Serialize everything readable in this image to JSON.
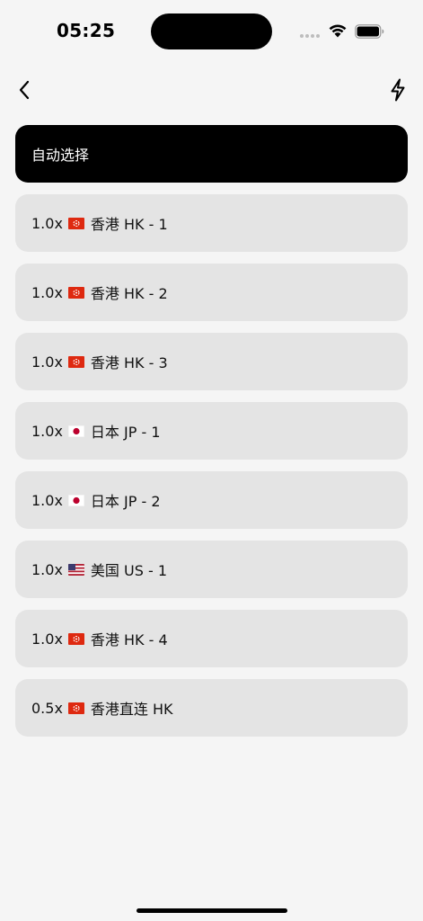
{
  "status_bar": {
    "time": "05:25"
  },
  "nav": {
    "back_icon": "chevron-left-icon",
    "action_icon": "lightning-bolt-icon"
  },
  "servers": [
    {
      "label": "自动选择",
      "selected": true
    },
    {
      "multiplier": "1.0x",
      "flag": "hk",
      "name": "香港 HK - 1"
    },
    {
      "multiplier": "1.0x",
      "flag": "hk",
      "name": "香港 HK - 2"
    },
    {
      "multiplier": "1.0x",
      "flag": "hk",
      "name": "香港 HK - 3"
    },
    {
      "multiplier": "1.0x",
      "flag": "jp",
      "name": "日本 JP - 1"
    },
    {
      "multiplier": "1.0x",
      "flag": "jp",
      "name": "日本 JP - 2"
    },
    {
      "multiplier": "1.0x",
      "flag": "us",
      "name": "美国 US - 1"
    },
    {
      "multiplier": "1.0x",
      "flag": "hk",
      "name": "香港 HK - 4"
    },
    {
      "multiplier": "0.5x",
      "flag": "hk",
      "name": "香港直连 HK"
    }
  ],
  "colors": {
    "background": "#f5f5f5",
    "item_bg": "#e4e4e4",
    "selected_bg": "#000000",
    "selected_text": "#ffffff",
    "hk_red": "#de2910",
    "jp_red": "#bc002d"
  }
}
